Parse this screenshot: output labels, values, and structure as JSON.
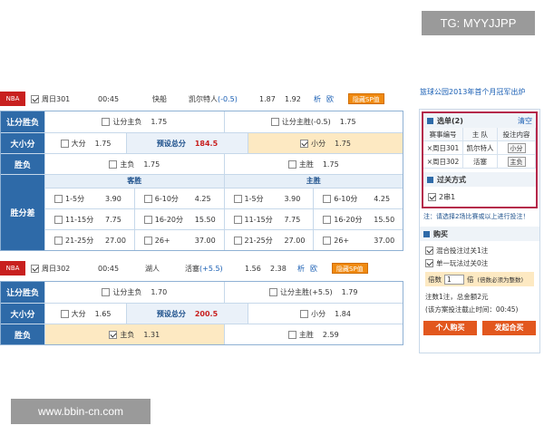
{
  "watermark_top": "TG: MYYJJPP",
  "watermark_bottom": "www.bbin-cn.com",
  "right_header_link": "篮球公园2013年首个月冠军出炉",
  "match1": {
    "league": "NBA",
    "day": "周日301",
    "time": "00:45",
    "home": "快船",
    "away": "凯尔特人",
    "handicap": "(-0.5)",
    "odd1": "1.87",
    "odd2": "1.92",
    "analysis": "析",
    "odds": "欧",
    "sp_button": "隐藏SP值",
    "rows": {
      "rq_label": "让分胜负",
      "rq_away": "让分主负",
      "rq_away_v": "1.75",
      "rq_home": "让分主胜(-0.5)",
      "rq_home_v": "1.75",
      "dx_label": "大小分",
      "dx_big": "大分",
      "dx_big_v": "1.75",
      "dx_pre": "预设总分",
      "dx_pre_v": "184.5",
      "dx_small": "小分",
      "dx_small_v": "1.75",
      "sf_label": "胜负",
      "sf_lose": "主负",
      "sf_lose_v": "1.75",
      "sf_win": "主胜",
      "sf_win_v": "1.75",
      "sfc_label": "胜分差",
      "guest": "客胜",
      "host": "主胜",
      "cells": [
        [
          "1-5分",
          "3.90",
          "6-10分",
          "4.25",
          "1-5分",
          "3.90",
          "6-10分",
          "4.25"
        ],
        [
          "11-15分",
          "7.75",
          "16-20分",
          "15.50",
          "11-15分",
          "7.75",
          "16-20分",
          "15.50"
        ],
        [
          "21-25分",
          "27.00",
          "26+",
          "37.00",
          "21-25分",
          "27.00",
          "26+",
          "37.00"
        ]
      ]
    }
  },
  "match2": {
    "league": "NBA",
    "day": "周日302",
    "time": "00:45",
    "home": "湖人",
    "away": "活塞",
    "handicap": "(+5.5)",
    "odd1": "1.56",
    "odd2": "2.38",
    "analysis": "析",
    "odds": "欧",
    "sp_button": "隐藏SP值",
    "rows": {
      "rq_label": "让分胜负",
      "rq_away": "让分主负",
      "rq_away_v": "1.70",
      "rq_home": "让分主胜(+5.5)",
      "rq_home_v": "1.79",
      "dx_label": "大小分",
      "dx_big": "大分",
      "dx_big_v": "1.65",
      "dx_pre": "预设总分",
      "dx_pre_v": "200.5",
      "dx_small": "小分",
      "dx_small_v": "1.84",
      "sf_label": "胜负",
      "sf_lose": "主负",
      "sf_lose_v": "1.31",
      "sf_win": "主胜",
      "sf_win_v": "2.59"
    }
  },
  "panel": {
    "sel_title": "选单(2)",
    "clear": "清空",
    "th": [
      "赛事编号",
      "主 队",
      "投注内容"
    ],
    "items": [
      [
        "×周日301",
        "凯尔特人",
        "小分"
      ],
      [
        "×周日302",
        "活塞",
        "主负"
      ]
    ],
    "pass_title": "过关方式",
    "pass_opt": "2串1",
    "note": "注：请选择2场比赛或以上进行投注！",
    "buy_title": "购买",
    "opt1": "混合投注过关1注",
    "opt2": "单一玩法过关0注",
    "mult_label": "倍数",
    "mult_value": "1",
    "mult_unit": "倍",
    "mult_hint": "(倍数必须为整数)",
    "summary": "注数1注，总金额2元",
    "deadline": "(该方案投注截止时间：00:45)",
    "buy_btn": "个人购买",
    "launch_btn": "发起合买"
  }
}
